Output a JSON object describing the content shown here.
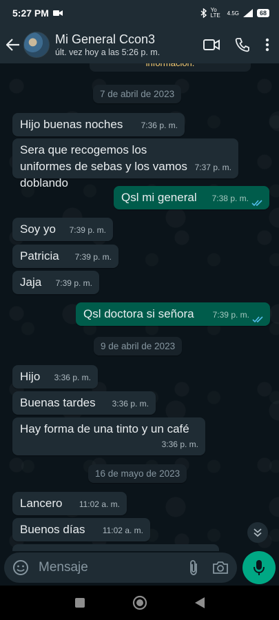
{
  "status_bar": {
    "time": "5:27 PM",
    "network": "Yo LTE",
    "signal": "4.5G",
    "battery": "68"
  },
  "header": {
    "contact_name": "Mi General Ccon3",
    "last_seen": "últ. vez hoy a las 5:26 p. m."
  },
  "chat": {
    "info_banner": "información.",
    "dates": [
      "7 de abril de 2023",
      "9 de abril de 2023",
      "16 de mayo de 2023"
    ],
    "messages": [
      {
        "dir": "in",
        "text": "Hijo buenas noches",
        "time": "7:36 p. m."
      },
      {
        "dir": "in",
        "text": "Sera que recogemos los uniformes de sebas y los vamos doblando",
        "time": "7:37 p. m."
      },
      {
        "dir": "out",
        "text": "Qsl mi general",
        "time": "7:38 p. m.",
        "status": "read"
      },
      {
        "dir": "in",
        "text": "Soy yo",
        "time": "7:39 p. m."
      },
      {
        "dir": "in",
        "text": "Patricia",
        "time": "7:39 p. m."
      },
      {
        "dir": "in",
        "text": "Jaja",
        "time": "7:39 p. m."
      },
      {
        "dir": "out",
        "text": "Qsl doctora si señora",
        "time": "7:39 p. m.",
        "status": "read"
      },
      {
        "dir": "in",
        "text": "Hijo",
        "time": "3:36 p. m."
      },
      {
        "dir": "in",
        "text": "Buenas tardes",
        "time": "3:36 p. m."
      },
      {
        "dir": "in",
        "text": "Hay forma de una tinto y un café",
        "time": "3:36 p. m."
      },
      {
        "dir": "in",
        "text": "Lancero",
        "time": "11:02 a. m."
      },
      {
        "dir": "in",
        "text": "Buenos días",
        "time": "11:02 a. m."
      }
    ]
  },
  "composer": {
    "placeholder": "Mensaje"
  },
  "icons": {
    "back": "arrow-left-icon",
    "video": "video-camera-icon",
    "call": "phone-icon",
    "menu": "more-vertical-icon",
    "emoji": "emoji-icon",
    "attach": "paperclip-icon",
    "camera": "camera-icon",
    "mic": "microphone-icon",
    "scroll": "double-chevron-down-icon"
  },
  "colors": {
    "bg": "#0b141a",
    "incoming": "#1f2c34",
    "outgoing": "#005c4b",
    "accent": "#00a884",
    "read_ticks": "#53bdeb"
  }
}
